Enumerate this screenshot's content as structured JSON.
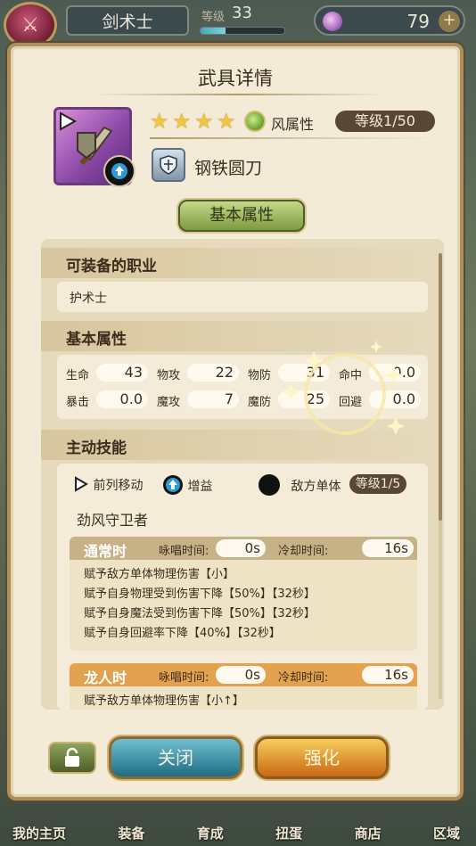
{
  "topbar": {
    "job": "剑术士",
    "level_label": "等级",
    "level_value": "33",
    "level_progress": 0.3,
    "gems": "79"
  },
  "panel": {
    "title": "武具详情",
    "item": {
      "stars": [
        "★",
        "★",
        "★",
        "★"
      ],
      "element_label": "风属性",
      "level": "等级1/50",
      "name": "钢铁圆刀"
    },
    "tab": "基本属性",
    "sections": {
      "jobs_title": "可装备的职业",
      "jobs_value": "护术士",
      "stats_title": "基本属性",
      "stats": [
        {
          "label": "生命",
          "value": "43"
        },
        {
          "label": "物攻",
          "value": "22"
        },
        {
          "label": "物防",
          "value": "31"
        },
        {
          "label": "命中",
          "value": "0.0"
        },
        {
          "label": "暴击",
          "value": "0.0"
        },
        {
          "label": "魔攻",
          "value": "7"
        },
        {
          "label": "魔防",
          "value": "25"
        },
        {
          "label": "回避",
          "value": "0.0"
        }
      ],
      "skill_title": "主动技能",
      "skill_tags": [
        "前列移动",
        "增益",
        "敌方单体"
      ],
      "skill_level": "等级1/5",
      "skill_name": "劲风守卫者",
      "normal": {
        "title": "通常时",
        "cast_label": "咏唱时间:",
        "cast_value": "0s",
        "cd_label": "冷却时间:",
        "cd_value": "16s",
        "lines": [
          "赋予敌方单体物理伤害【小】",
          "赋予自身物理受到伤害下降【50%】【32秒】",
          "赋予自身魔法受到伤害下降【50%】【32秒】",
          "赋予自身回避率下降【40%】【32秒】"
        ]
      },
      "dragon": {
        "title": "龙人时",
        "cast_label": "咏唱时间:",
        "cast_value": "0s",
        "cd_label": "冷却时间:",
        "cd_value": "16s",
        "lines": [
          "赋予敌方单体物理伤害【小↑】"
        ]
      }
    },
    "buttons": {
      "close": "关闭",
      "upgrade": "强化"
    }
  },
  "bottom_nav": [
    "我的主页",
    "装备",
    "育成",
    "扭蛋",
    "商店",
    "区域"
  ]
}
